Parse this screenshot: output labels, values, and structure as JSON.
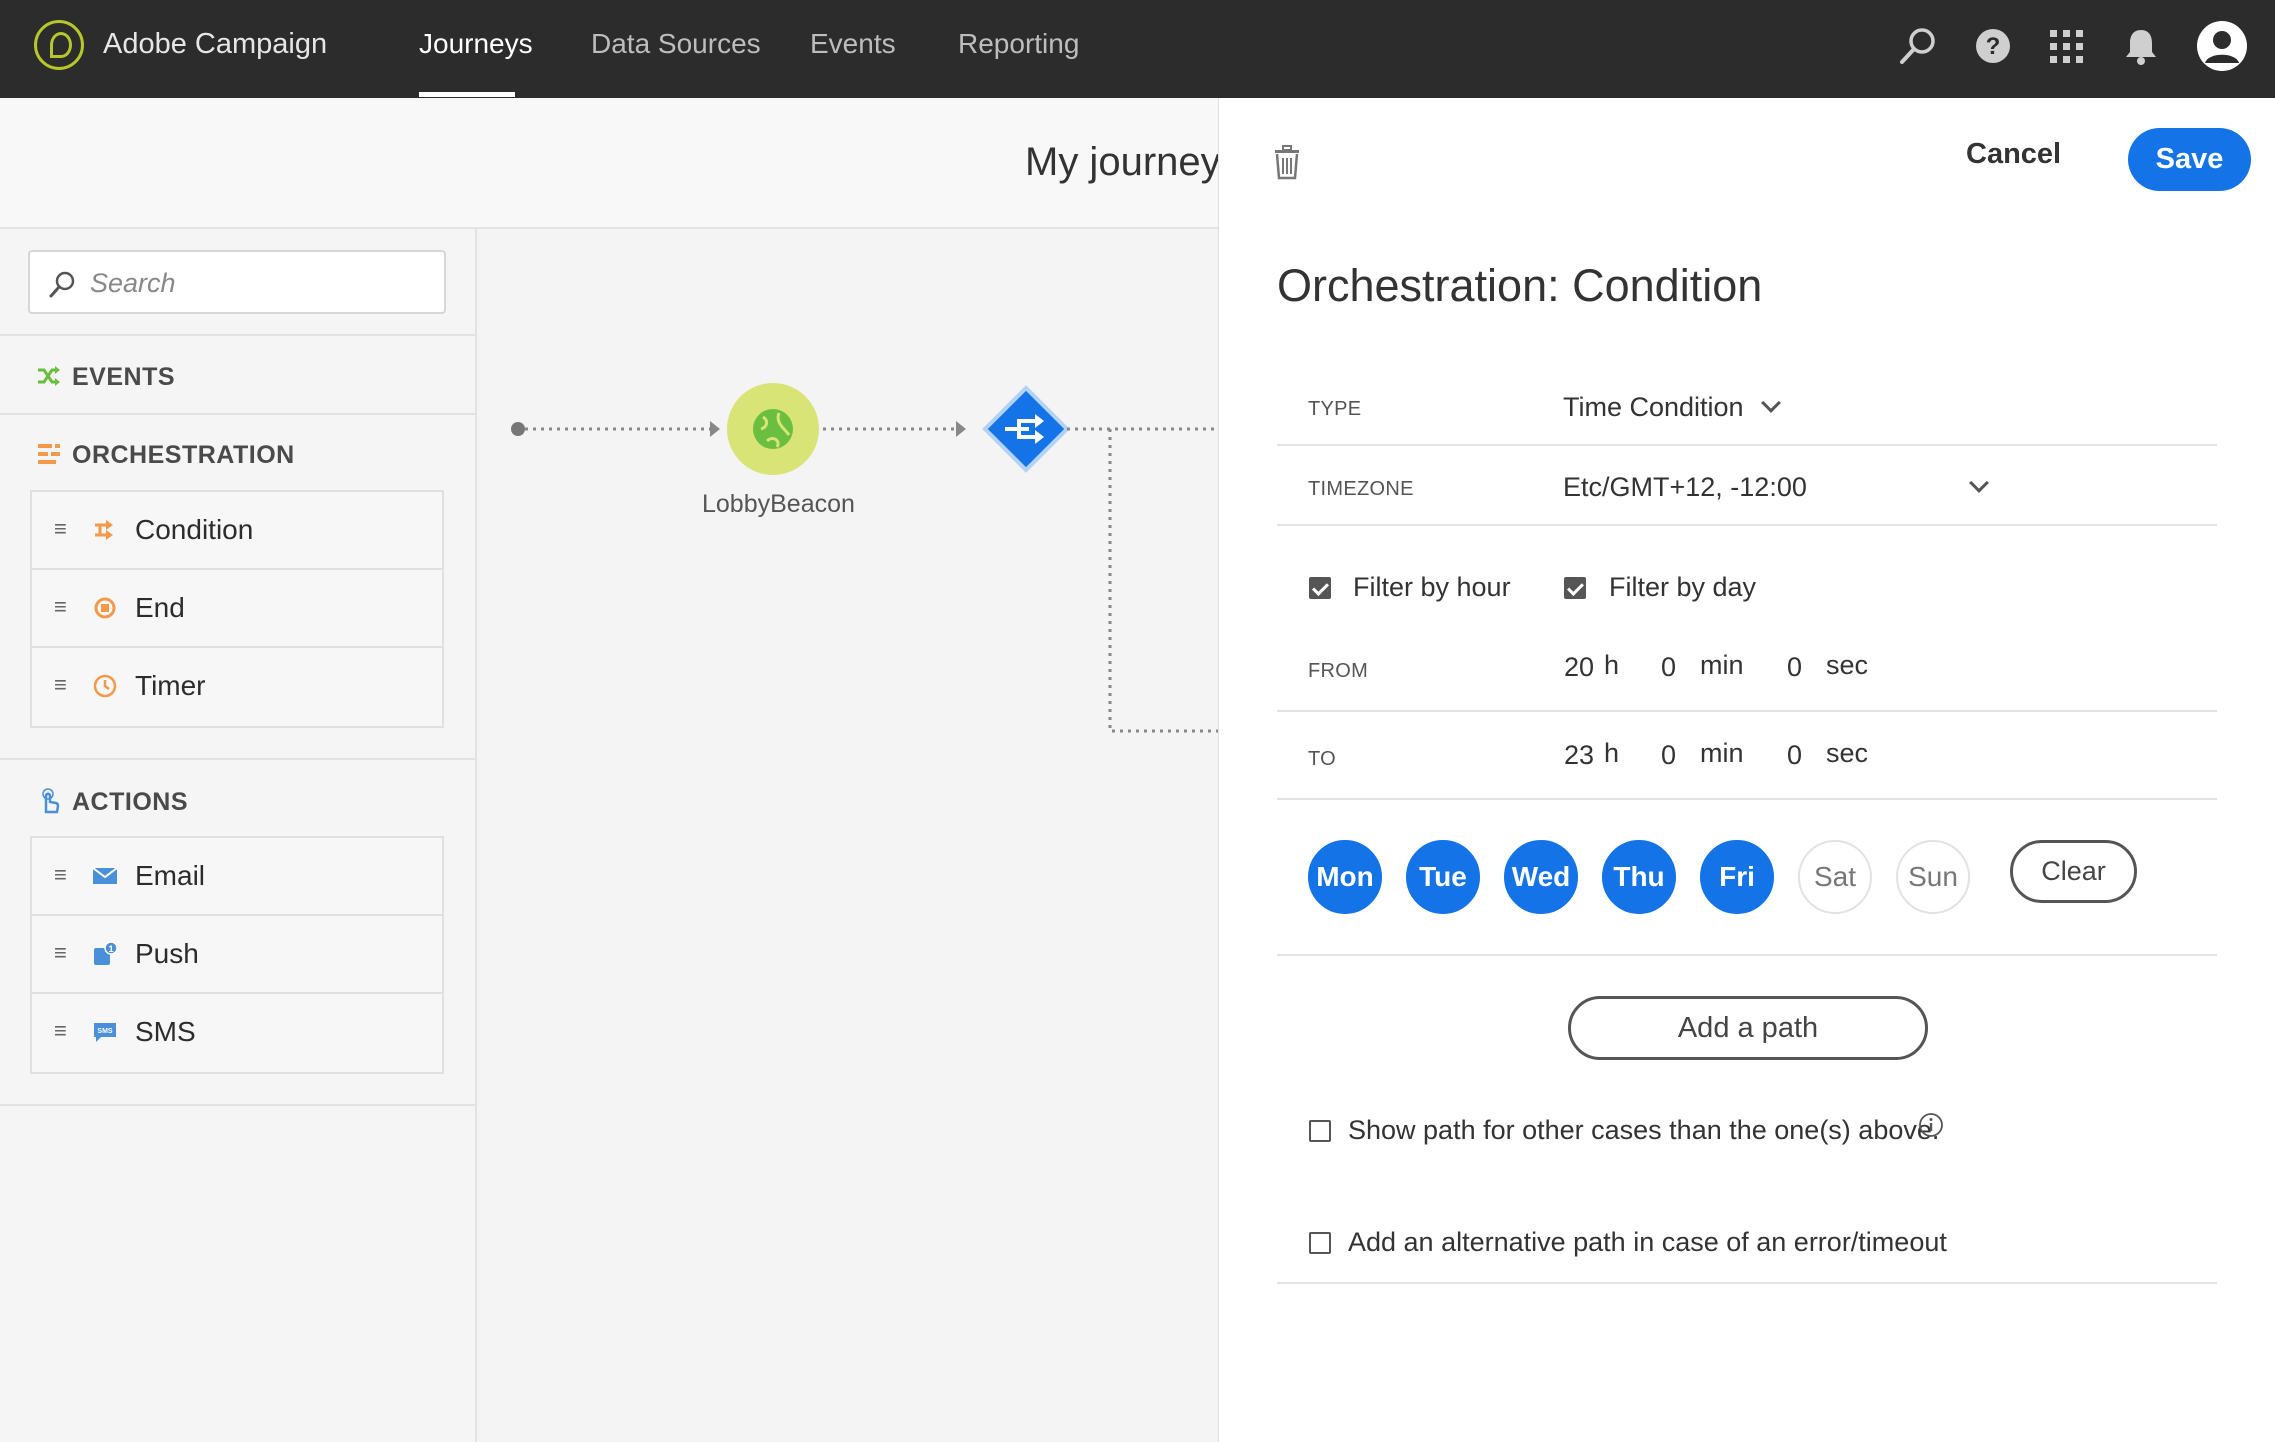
{
  "topbar": {
    "brand": "Adobe Campaign",
    "nav": [
      "Journeys",
      "Data Sources",
      "Events",
      "Reporting"
    ],
    "active_nav": "Journeys"
  },
  "journey": {
    "title": "My journey"
  },
  "sidebar": {
    "search_placeholder": "Search",
    "sections": {
      "events": "EVENTS",
      "orchestration": "ORCHESTRATION",
      "actions": "ACTIONS"
    },
    "orchestration_items": [
      "Condition",
      "End",
      "Timer"
    ],
    "action_items": [
      "Email",
      "Push",
      "SMS"
    ]
  },
  "canvas": {
    "event_node_label": "LobbyBeacon"
  },
  "panel": {
    "cancel": "Cancel",
    "save": "Save",
    "title": "Orchestration: Condition",
    "type_label": "TYPE",
    "type_value": "Time Condition",
    "timezone_label": "TIMEZONE",
    "timezone_value": "Etc/GMT+12, -12:00",
    "filter_by_hour": "Filter by hour",
    "filter_by_day": "Filter by day",
    "filter_by_hour_checked": true,
    "filter_by_day_checked": true,
    "from_label": "FROM",
    "to_label": "TO",
    "from": {
      "h": "20",
      "min": "0",
      "sec": "0"
    },
    "to": {
      "h": "23",
      "min": "0",
      "sec": "0"
    },
    "units": {
      "h": "h",
      "min": "min",
      "sec": "sec"
    },
    "days": [
      {
        "label": "Mon",
        "selected": true
      },
      {
        "label": "Tue",
        "selected": true
      },
      {
        "label": "Wed",
        "selected": true
      },
      {
        "label": "Thu",
        "selected": true
      },
      {
        "label": "Fri",
        "selected": true
      },
      {
        "label": "Sat",
        "selected": false
      },
      {
        "label": "Sun",
        "selected": false
      }
    ],
    "clear": "Clear",
    "add_path": "Add a path",
    "show_other_path": "Show path for other cases than the one(s) above.",
    "alt_path": "Add an alternative path in case of an error/timeout"
  },
  "colors": {
    "accent": "#1473e6",
    "topbar": "#2c2c2c",
    "event_node": "#d8e476",
    "orchestration_icon": "#f2994a",
    "actions_icon": "#4a90d9",
    "events_icon": "#6abf40"
  }
}
